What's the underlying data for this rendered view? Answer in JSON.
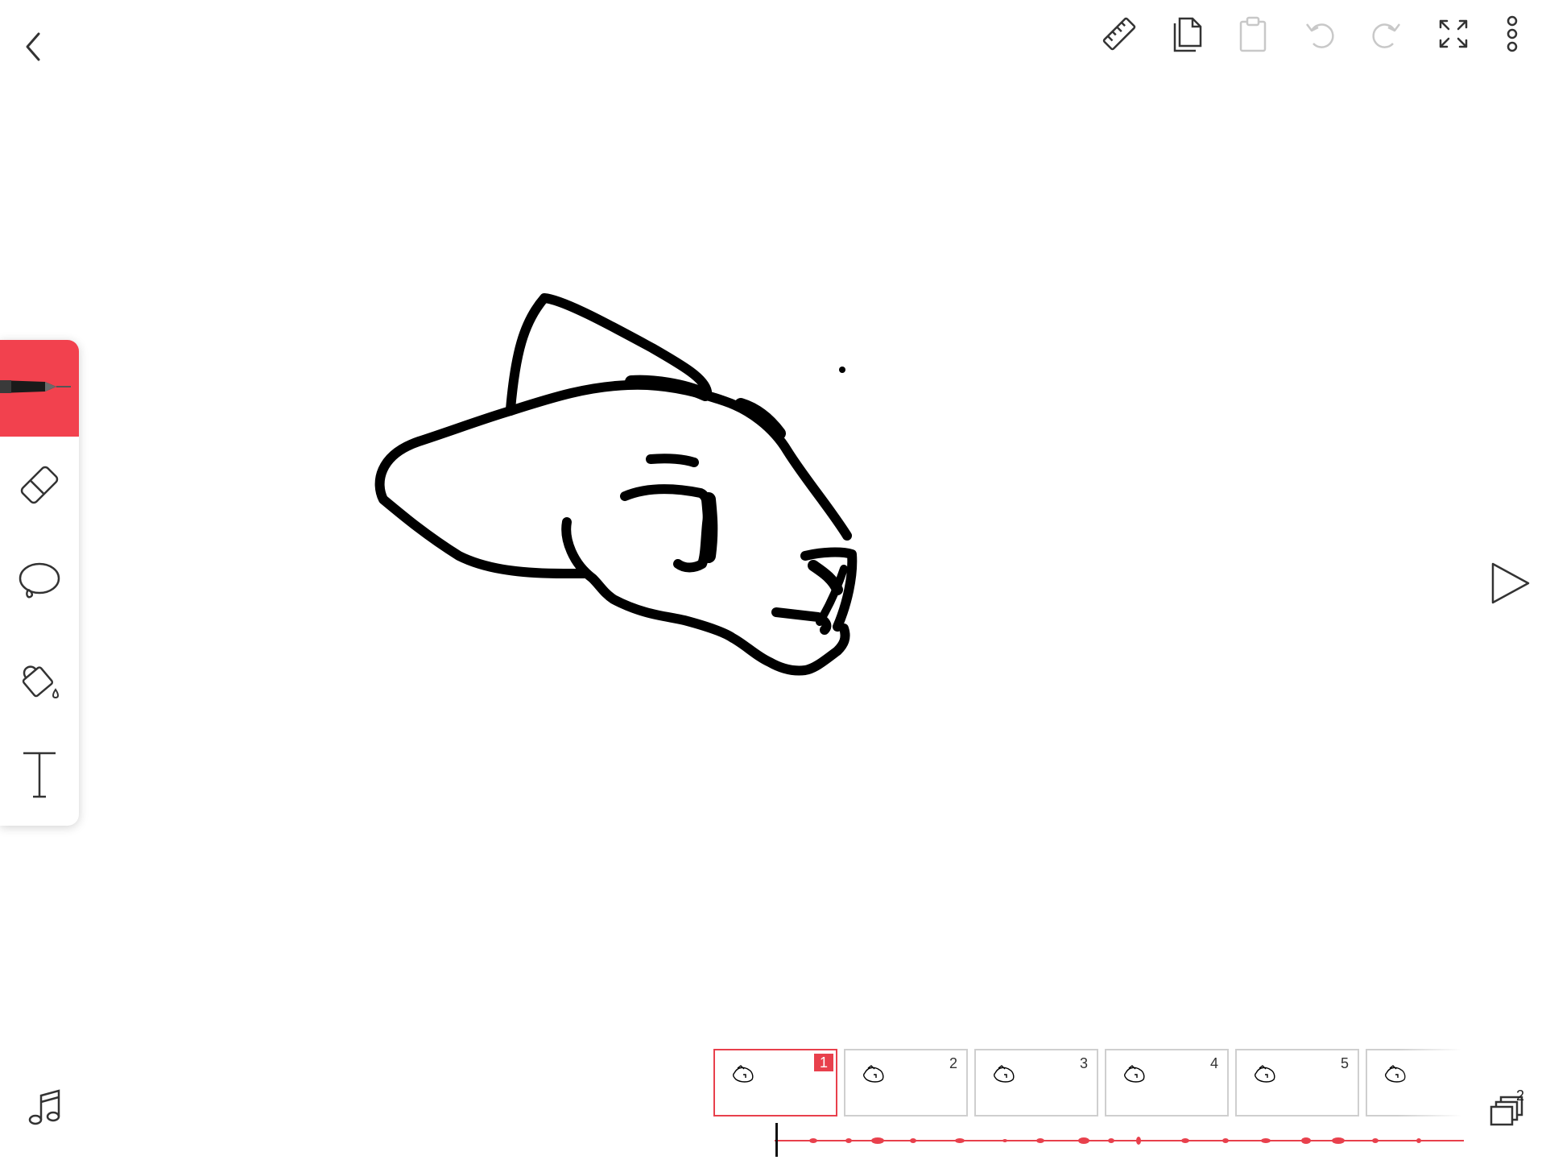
{
  "topbar": {
    "back_icon": "chevron-left-icon",
    "actions": [
      {
        "name": "ruler-button",
        "icon": "ruler-icon",
        "enabled": true
      },
      {
        "name": "copy-frame-button",
        "icon": "copy-icon",
        "enabled": true
      },
      {
        "name": "paste-frame-button",
        "icon": "clipboard-icon",
        "enabled": false
      },
      {
        "name": "undo-button",
        "icon": "undo-icon",
        "enabled": false
      },
      {
        "name": "redo-button",
        "icon": "redo-icon",
        "enabled": false
      },
      {
        "name": "fullscreen-button",
        "icon": "expand-icon",
        "enabled": true
      },
      {
        "name": "more-button",
        "icon": "more-vertical-icon",
        "enabled": true
      }
    ]
  },
  "tools": [
    {
      "name": "pen-tool",
      "icon": "pen-icon",
      "active": true
    },
    {
      "name": "eraser-tool",
      "icon": "eraser-icon",
      "active": false
    },
    {
      "name": "lasso-tool",
      "icon": "lasso-icon",
      "active": false
    },
    {
      "name": "fill-tool",
      "icon": "paint-bucket-icon",
      "active": false
    },
    {
      "name": "text-tool",
      "icon": "text-icon",
      "active": false
    }
  ],
  "timeline": {
    "frames": [
      {
        "number": "1",
        "selected": true
      },
      {
        "number": "2",
        "selected": false
      },
      {
        "number": "3",
        "selected": false
      },
      {
        "number": "4",
        "selected": false
      },
      {
        "number": "5",
        "selected": false
      },
      {
        "number": "",
        "selected": false
      }
    ],
    "layers_count": "2"
  },
  "colors": {
    "accent": "#f2414e",
    "stroke": "#000000",
    "disabled": "#c8c8c8"
  }
}
